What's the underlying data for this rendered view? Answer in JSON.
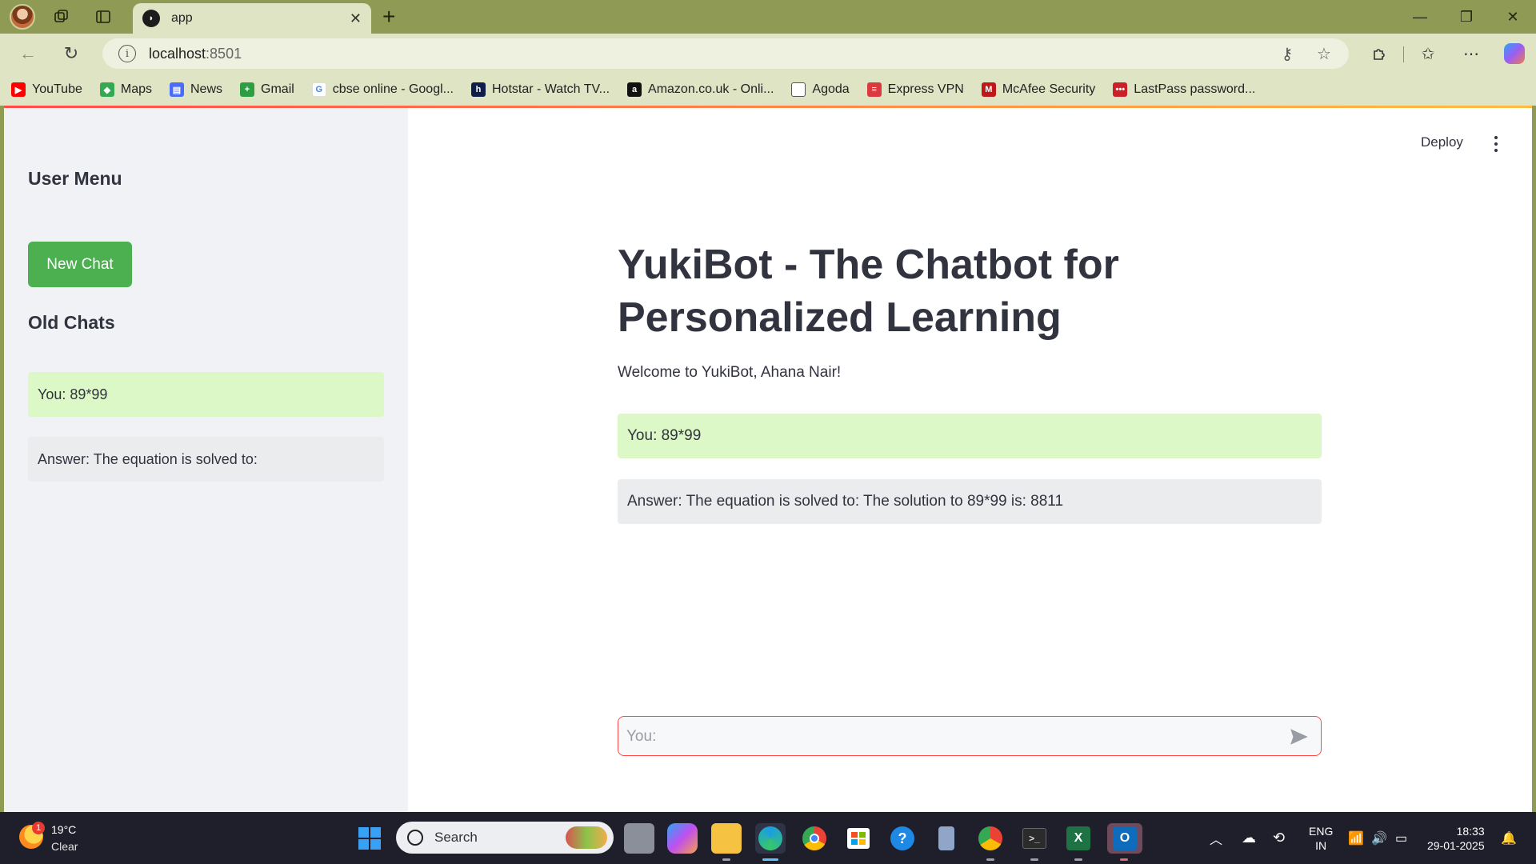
{
  "browser": {
    "tab_title": "app",
    "url_host": "localhost",
    "url_port": ":8501",
    "bookmarks": [
      {
        "label": "YouTube",
        "icon": "youtube-icon",
        "color": "#ff0000"
      },
      {
        "label": "Maps",
        "icon": "maps-icon",
        "color": "#34a853"
      },
      {
        "label": "News",
        "icon": "news-icon",
        "color": "#4a6cf7"
      },
      {
        "label": "Gmail",
        "icon": "gmail-icon",
        "color": "#2e9e44"
      },
      {
        "label": "cbse online - Googl...",
        "icon": "google-icon",
        "color": "#4285f4"
      },
      {
        "label": "Hotstar - Watch TV...",
        "icon": "hotstar-icon",
        "color": "#0f1d4a"
      },
      {
        "label": "Amazon.co.uk - Onli...",
        "icon": "amazon-icon",
        "color": "#111111"
      },
      {
        "label": "Agoda",
        "icon": "document-icon",
        "color": "#555555"
      },
      {
        "label": "Express VPN",
        "icon": "expressvpn-icon",
        "color": "#da3940"
      },
      {
        "label": "McAfee Security",
        "icon": "mcafee-icon",
        "color": "#c01818"
      },
      {
        "label": "LastPass password...",
        "icon": "lastpass-icon",
        "color": "#cc2029"
      }
    ]
  },
  "app": {
    "deploy_label": "Deploy",
    "sidebar": {
      "user_menu_heading": "User Menu",
      "new_chat_label": "New Chat",
      "old_chats_heading": "Old Chats",
      "old_chats": [
        {
          "role": "user",
          "text": "You: 89*99"
        },
        {
          "role": "bot",
          "text": "Answer: The equation is solved to:"
        }
      ]
    },
    "main": {
      "title": "YukiBot - The Chatbot for Personalized Learning",
      "welcome": "Welcome to YukiBot, Ahana Nair!",
      "messages": [
        {
          "role": "user",
          "text": "You: 89*99"
        },
        {
          "role": "bot",
          "text": "Answer: The equation is solved to: The solution to 89*99 is: 8811"
        }
      ],
      "input_placeholder": "You:"
    },
    "colors": {
      "user_bubble": "#dcf8c6",
      "bot_bubble": "#ebecee",
      "button_green": "#4caf50",
      "input_border": "#ff4b4b"
    }
  },
  "taskbar": {
    "weather_temp": "19°C",
    "weather_desc": "Clear",
    "weather_badge": "1",
    "search_label": "Search",
    "lang_top": "ENG",
    "lang_bottom": "IN",
    "time": "18:33",
    "date": "29-01-2025"
  }
}
